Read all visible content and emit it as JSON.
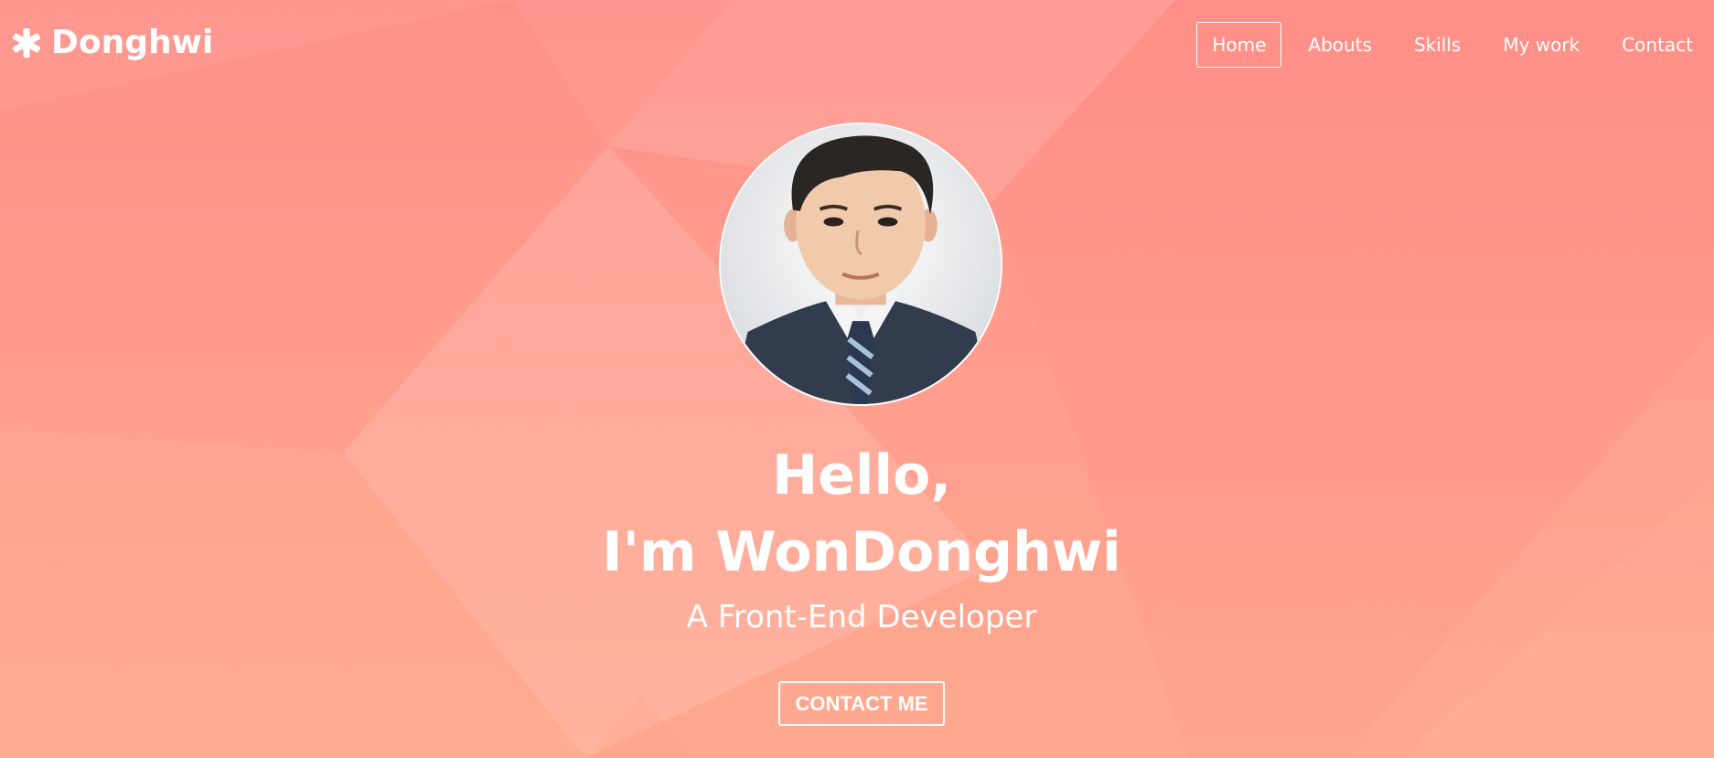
{
  "brand": {
    "name": "Donghwi",
    "icon": "asterisk-icon"
  },
  "nav": {
    "items": [
      {
        "label": "Home",
        "active": true
      },
      {
        "label": "Abouts",
        "active": false
      },
      {
        "label": "Skills",
        "active": false
      },
      {
        "label": "My work",
        "active": false
      },
      {
        "label": "Contact",
        "active": false
      }
    ]
  },
  "hero": {
    "line1": "Hello,",
    "line2": "I'm WonDonghwi",
    "subtitle": "A Front-End Developer",
    "cta_label": "CONTACT ME",
    "photo": "profile-photo"
  },
  "colors": {
    "background_top": "#ff9189",
    "background_bottom": "#ffa98f",
    "text": "#ffffff"
  }
}
